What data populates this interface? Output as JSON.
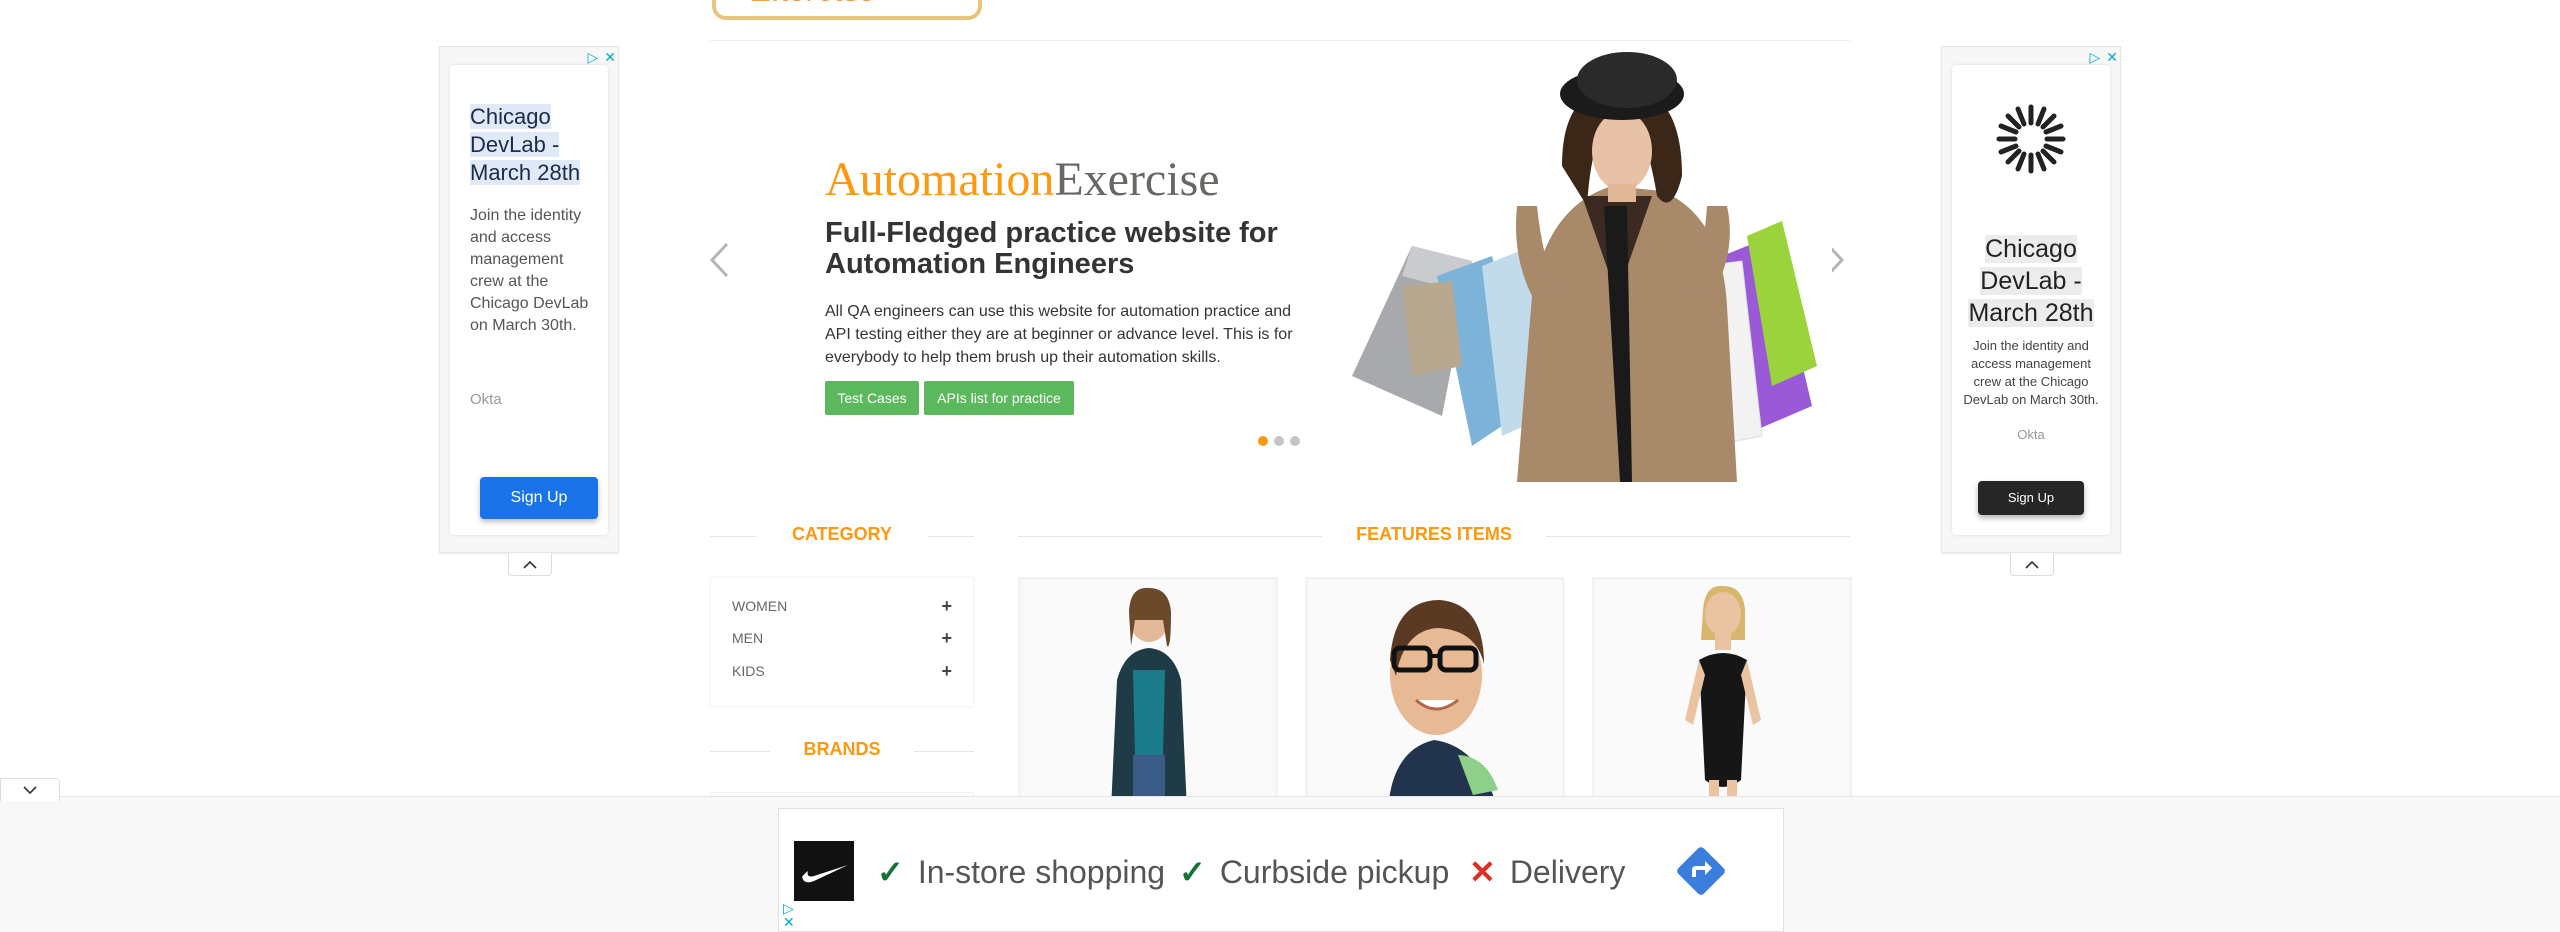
{
  "header": {
    "logo_text": "Exercise"
  },
  "left_ad": {
    "title": "Chicago DevLab - March 28th",
    "body": "Join the identity and access management crew at the Chicago DevLab on March 30th.",
    "brand": "Okta",
    "cta": "Sign Up",
    "cta_color": "#1a73e8"
  },
  "right_ad": {
    "title": "Chicago DevLab - March 28th",
    "body": "Join the identity and access management crew at the Chicago DevLab on March 30th.",
    "brand": "Okta",
    "cta": "Sign Up",
    "cta_color": "#262626"
  },
  "slider": {
    "brand_part1": "Automation",
    "brand_part2": "Exercise",
    "title": "Full-Fledged practice website for Automation Engineers",
    "description": "All QA engineers can use this website for automation practice and API testing either they are at beginner or advance level. This is for everybody to help them brush up their automation skills.",
    "buttons": [
      "Test Cases",
      "APIs list for practice"
    ],
    "slide_count": 3,
    "active_slide": 1,
    "prev_icon": "‹",
    "next_icon": "›"
  },
  "category": {
    "title": "CATEGORY",
    "items": [
      {
        "label": "WOMEN",
        "toggle": "+"
      },
      {
        "label": "MEN",
        "toggle": "+"
      },
      {
        "label": "KIDS",
        "toggle": "+"
      }
    ]
  },
  "brands": {
    "title": "BRANDS"
  },
  "features": {
    "title": "FEATURES ITEMS"
  },
  "bottom_ad": {
    "features": [
      {
        "label": "In-store shopping",
        "mark": "✓",
        "available": true
      },
      {
        "label": "Curbside pickup",
        "mark": "✓",
        "available": true
      },
      {
        "label": "Delivery",
        "mark": "✕",
        "available": false
      }
    ]
  },
  "colors": {
    "accent": "#fe980f",
    "green_button": "#5cb85c",
    "brand_grey": "#696763"
  }
}
